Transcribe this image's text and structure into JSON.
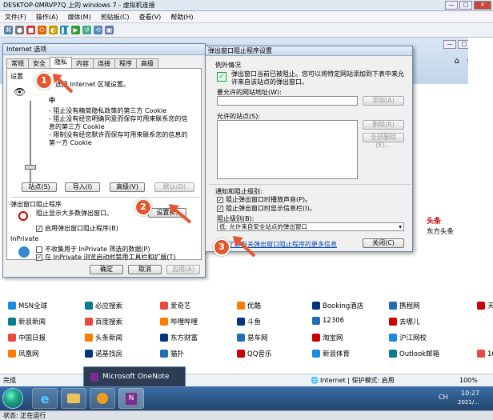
{
  "vm": {
    "title": "DESKTOP-0MRVP7Q 上的 windows 7 - 虚拟机连接",
    "menu": [
      "文件(F)",
      "操作(A)",
      "媒体(M)",
      "剪贴板(C)",
      "查看(V)",
      "帮助(H)"
    ],
    "status": "状态: 正在运行"
  },
  "inet_options": {
    "title": "Internet 选项",
    "tabs": [
      "常规",
      "安全",
      "隐私",
      "内容",
      "连接",
      "程序",
      "高级"
    ],
    "settings_label": "设置",
    "zone_text": "选择 Internet 区域设置。",
    "level": "中",
    "desc_1": "- 阻止没有精简隐私政策的第三方 Cookie",
    "desc_2": "- 阻止没有经您明确同意而保存可用来联系您的信息的第三方 Cookie",
    "desc_3": "- 限制没有经您默许而保存可用来联系您的信息的第一方 Cookie",
    "btn_sites": "站点(S)",
    "btn_import": "导入(I)",
    "btn_advanced": "高级(V)",
    "btn_default": "默认(D)",
    "popup_group": "弹出窗口阻止程序",
    "popup_desc": "阻止显示大多数弹出窗口。",
    "btn_settings": "设置(E)",
    "chk_enable_popup": "启用弹出窗口阻止程序(B)",
    "inprivate_label": "InPrivate",
    "chk_inprivate_filter": "不收集用于 InPrivate 筛选的数据(P)",
    "chk_inprivate_toolbar": "在 InPrivate 浏览启动时禁用工具栏和扩展(T)",
    "btn_ok": "确定",
    "btn_cancel": "取消",
    "btn_apply": "应用(A)"
  },
  "popup_settings": {
    "title": "弹出窗口阻止程序设置",
    "exceptions_label": "例外情况",
    "exceptions_desc": "弹出窗口当前已被阻止。您可以将特定网站添加到下表中来允许来自该站点的弹出窗口。",
    "address_label": "要允许的网站地址(W):",
    "btn_add": "添加(A)",
    "allowed_label": "允许的站点(S):",
    "btn_delete": "删除(R)",
    "btn_delete_all": "全部删除(E)...",
    "notify_label": "通知和阻止级别:",
    "chk_sound": "阻止弹出窗口时播放声音(P)。",
    "chk_infobar": "阻止弹出窗口时显示信息栏(I)。",
    "block_level_label": "阻止级别(B):",
    "block_level_value": "低: 允许来自安全站点的弹出窗口",
    "learn_more": "了解有关弹出窗口阻止程序的更多信息",
    "btn_close": "关闭(C)"
  },
  "news_side": {
    "item_1": "头条",
    "item_2": "东方头条"
  },
  "links": [
    [
      "MSN全球",
      "必应搜索",
      "爱奇艺",
      "优酷",
      "Booking酒店",
      "携程网",
      "天"
    ],
    [
      "新浪新闻",
      "百度搜索",
      "哔哩哔哩",
      "斗鱼",
      "12306",
      "去哪儿",
      ""
    ],
    [
      "中国日报",
      "头条新闻",
      "东方财富",
      "易车网",
      "淘宝网",
      "沪江网校",
      ""
    ],
    [
      "凤凰网",
      "诺基找房",
      "猫扑",
      "QQ音乐",
      "新浪体育",
      "Outlook邮箱",
      "163邮"
    ]
  ],
  "ie_status": {
    "done": "完成",
    "zone": "Internet | 保护模式: 启用",
    "zoom": "100%"
  },
  "taskbar": {
    "onenote_popup": "Microsoft OneNote",
    "lang": "CH",
    "time": "10:27",
    "date": "2021/..."
  },
  "annotations": [
    "1",
    "2",
    "3"
  ],
  "colors": {
    "accent_badge": "#e4572e",
    "arrow": "#e4572e",
    "link_blue": "#0645ad"
  }
}
